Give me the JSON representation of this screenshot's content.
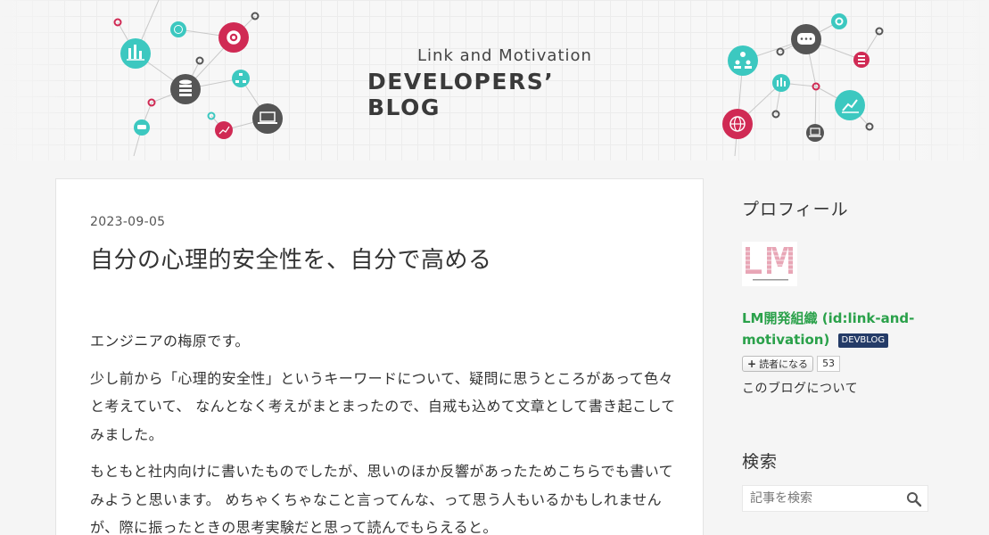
{
  "header": {
    "subtitle": "Link and Motivation",
    "title": "DEVELOPERS’ BLOG"
  },
  "article": {
    "date": "2023-09-05",
    "title": "自分の心理的安全性を、自分で高める",
    "paragraphs": [
      "エンジニアの梅原です。",
      "少し前から「心理的安全性」というキーワードについて、疑問に思うところがあって色々と考えていて、 なんとなく考えがまとまったので、自戒も込めて文章として書き起こしてみました。",
      "もともと社内向けに書いたものでしたが、思いのほか反響があったためこちらでも書いてみようと思います。 めちゃくちゃなこと言ってんな、って思う人もいるかもしれませんが、際に振ったときの思考実験だと思って読んでもらえると。"
    ]
  },
  "sidebar": {
    "profile_heading": "プロフィール",
    "profile_logo_text": "LM",
    "profile_name_line1": "LM開発組織 (id:link-and-",
    "profile_name_line2": "motivation)",
    "badge": "DEVBLOG",
    "reader_button": "読者になる",
    "reader_count": "53",
    "about_link": "このブログについて",
    "search_heading": "検索",
    "search_placeholder": "記事を検索"
  },
  "colors": {
    "accent_teal": "#3cc8c0",
    "accent_red": "#d02a54",
    "node_gray": "#555555",
    "profile_green": "#2aa14a",
    "badge_navy": "#243b67"
  },
  "icons": [
    "chart-icon",
    "gear-icon",
    "database-icon",
    "globe-icon",
    "chat-icon",
    "laptop-icon",
    "users-icon",
    "sitemap-icon",
    "search-icon",
    "plus-icon"
  ]
}
